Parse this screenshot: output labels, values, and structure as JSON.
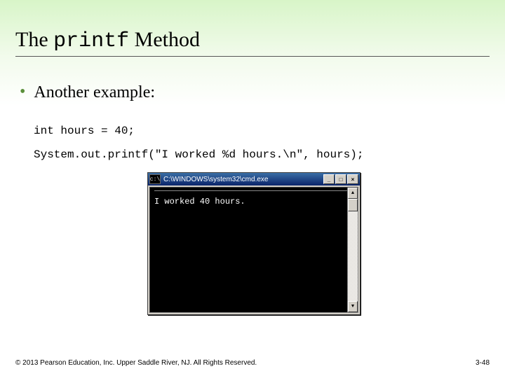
{
  "title": {
    "pre": "The ",
    "mono": "printf",
    "post": " Method"
  },
  "bullet_text": "Another example:",
  "code": {
    "line1": "int hours = 40;",
    "line2": "System.out.printf(\"I worked %d hours.\\n\", hours);"
  },
  "console": {
    "icon_text": "c:\\",
    "caption": "C:\\WINDOWS\\system32\\cmd.exe",
    "output": "I worked 40 hours.",
    "min_label": "_",
    "max_label": "□",
    "close_label": "×",
    "scroll_up": "▲",
    "scroll_down": "▼"
  },
  "footer": {
    "copyright": "© 2013 Pearson Education, Inc. Upper Saddle River, NJ. All Rights Reserved.",
    "page": "3-48"
  }
}
